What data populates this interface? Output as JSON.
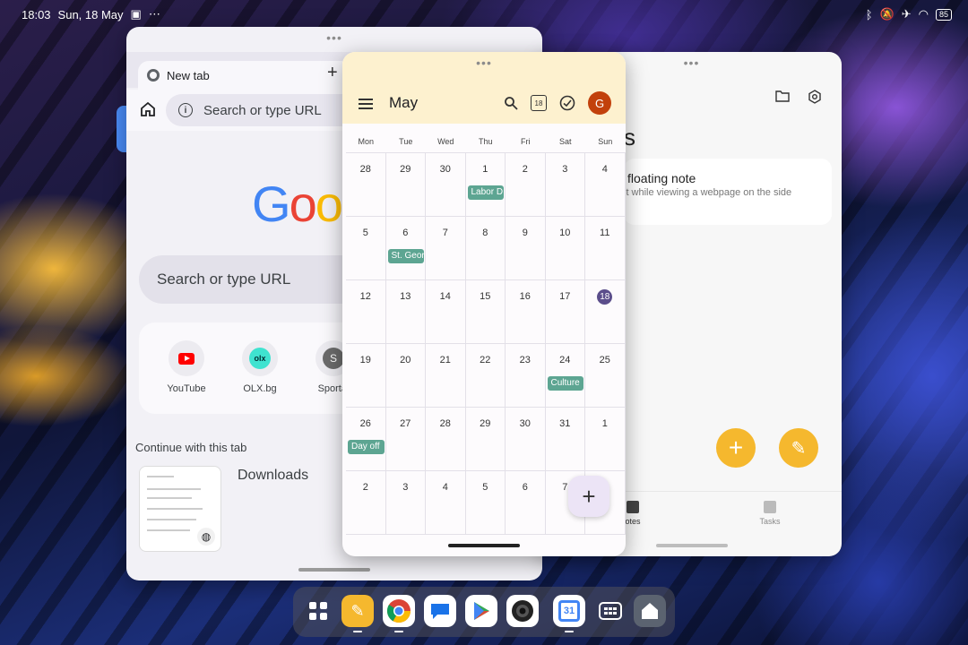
{
  "status_bar": {
    "time": "18:03",
    "date": "Sun, 18 May",
    "overflow": "⋯",
    "battery": "85",
    "icons": [
      "bluetooth-icon",
      "mute-icon",
      "airplane-icon",
      "wifi-icon"
    ]
  },
  "chrome": {
    "tab_title": "New tab",
    "tab_close": "✕",
    "new_tab": "+",
    "omnibox_placeholder": "Search or type URL",
    "logo_letters": [
      "G",
      "o",
      "o"
    ],
    "search_placeholder": "Search or type URL",
    "shortcuts": [
      {
        "label": "YouTube",
        "icon": "youtube-icon"
      },
      {
        "label": "OLX.bg",
        "icon": "olx-icon",
        "badge": "olx"
      },
      {
        "label": "Sportal",
        "icon": "sportal-icon",
        "badge": "S"
      }
    ],
    "continue_label": "Continue with this tab",
    "continue_item": "Downloads"
  },
  "calendar": {
    "month": "May",
    "avatar_initial": "G",
    "mini_date": "18",
    "weekdays": [
      "Mon",
      "Tue",
      "Wed",
      "Thu",
      "Fri",
      "Sat",
      "Sun"
    ],
    "weeks": [
      [
        "28",
        "29",
        "30",
        "1",
        "2",
        "3",
        "4"
      ],
      [
        "5",
        "6",
        "7",
        "8",
        "9",
        "10",
        "11"
      ],
      [
        "12",
        "13",
        "14",
        "15",
        "16",
        "17",
        "18"
      ],
      [
        "19",
        "20",
        "21",
        "22",
        "23",
        "24",
        "25"
      ],
      [
        "26",
        "27",
        "28",
        "29",
        "30",
        "31",
        "1"
      ],
      [
        "2",
        "3",
        "4",
        "5",
        "6",
        "7",
        "8"
      ]
    ],
    "today": "18",
    "events": [
      {
        "label": "Labor D",
        "week": 0,
        "day": 3
      },
      {
        "label": "St. Geor",
        "week": 1,
        "day": 1
      },
      {
        "label": "Culture",
        "week": 3,
        "day": 5
      },
      {
        "label": "Day off",
        "week": 4,
        "day": 0
      }
    ],
    "fab": "+",
    "event_color": "#5da592",
    "header_color": "#fdf1cf"
  },
  "notes": {
    "title": "s",
    "card_title": "floating note",
    "card_subtitle": "it while viewing a webpage on the side",
    "fab_add": "+",
    "fab_draw": "✎",
    "nav": [
      {
        "label": "otes",
        "icon": "notes-icon"
      },
      {
        "label": "Tasks",
        "icon": "tasks-icon"
      }
    ],
    "accent": "#f5b82e"
  },
  "dock": {
    "apps": [
      "app-drawer-icon",
      "notes-app-icon",
      "chrome-app-icon",
      "messages-app-icon",
      "play-store-icon",
      "camera-app-icon",
      "calendar-app-icon",
      "multitask-icon",
      "home-app-icon"
    ],
    "calendar_day": "31"
  }
}
